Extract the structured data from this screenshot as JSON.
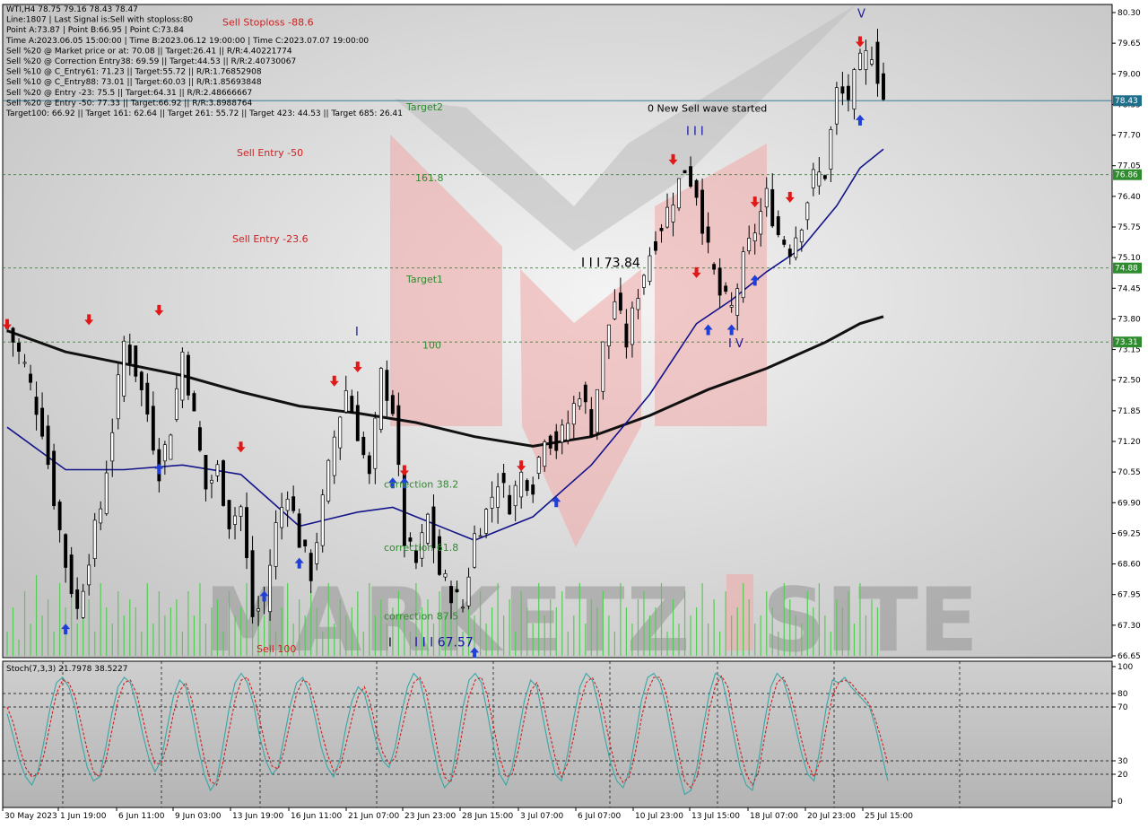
{
  "chart_data": [
    {
      "type": "candlestick",
      "symbol": "WTI,H4",
      "ohlc": {
        "open": 78.75,
        "high": 79.16,
        "low": 78.43,
        "close": 78.47
      },
      "info_lines": [
        "WTI,H4  78.75 79.16 78.43 78.47",
        "Line:1807 | Last Signal is:Sell with stoploss:80",
        "Point A:73.87 | Point B:66.95 | Point C:73.84",
        "Time A:2023.06.05 15:00:00 | Time B:2023.06.12 19:00:00 | Time C:2023.07.07 19:00:00",
        "Sell %20 @ Market price or at: 70.08 || Target:26.41 || R/R:4.40221774",
        "Sell %20 @ Correction Entry38: 69.59 || Target:44.53 || R/R:2.40730067",
        "Sell %10 @ C_Entry61: 71.23 || Target:55.72 || R/R:1.76852908",
        "Sell %10 @ C_Entry88: 73.01 || Target:60.03 || R/R:1.85693848",
        "Sell %20 @ Entry -23: 75.5 || Target:64.31 || R/R:2.48666667",
        "Sell %20 @ Entry -50: 77.33 || Target:66.92 || R/R:3.8988764",
        "Target100: 66.92 || Target 161: 62.64 || Target 261: 55.72 || Target 423: 44.53 || Target 685: 26.41"
      ],
      "y_ticks": [
        "80.30",
        "79.65",
        "79.00",
        "78.35",
        "77.70",
        "77.05",
        "76.40",
        "75.75",
        "75.10",
        "74.45",
        "73.80",
        "73.15",
        "72.50",
        "71.85",
        "71.20",
        "70.55",
        "69.90",
        "69.25",
        "68.60",
        "67.95",
        "67.30",
        "66.65"
      ],
      "ylim": [
        66.65,
        80.3
      ],
      "price_badges": [
        {
          "label": "78.43",
          "value": 78.43,
          "color": "#1f6f8b"
        },
        {
          "label": "76.86",
          "value": 76.86,
          "color": "#2e8b2e"
        },
        {
          "label": "74.88",
          "value": 74.88,
          "color": "#2e8b2e"
        },
        {
          "label": "73.31",
          "value": 73.31,
          "color": "#2e8b2e"
        }
      ],
      "levels": [
        {
          "label": "Sell Stoploss -88.6",
          "value": 80.1,
          "color": "#cc2222"
        },
        {
          "label": "Target2",
          "value": 78.3,
          "color": "#2e8b2e"
        },
        {
          "label": "Sell Entry -50",
          "value": 77.33,
          "color": "#cc2222"
        },
        {
          "label": "161.8",
          "value": 76.8,
          "color": "#2e8b2e"
        },
        {
          "label": "Sell Entry -23.6",
          "value": 75.5,
          "color": "#cc2222"
        },
        {
          "label": "Target1",
          "value": 74.65,
          "color": "#2e8b2e"
        },
        {
          "label": "100",
          "value": 73.25,
          "color": "#2e8b2e"
        },
        {
          "label": "correction 38.2",
          "value": 70.3,
          "color": "#2e8b2e"
        },
        {
          "label": "correction 61.8",
          "value": 68.95,
          "color": "#2e8b2e"
        },
        {
          "label": "correction 87.5",
          "value": 67.5,
          "color": "#2e8b2e"
        },
        {
          "label": "Sell 100",
          "value": 66.8,
          "color": "#cc2222"
        }
      ],
      "annotations": [
        {
          "text": "0 New Sell wave started",
          "value": 78.2,
          "color": "#000000"
        },
        {
          "text": "I I I 73.84",
          "value": 74.9,
          "color": "#000000"
        },
        {
          "text": "I I I",
          "value": 77.7,
          "color": "#1a1aa0"
        },
        {
          "text": "I V",
          "value": 73.2,
          "color": "#1a1aa0"
        },
        {
          "text": "V",
          "value": 80.2,
          "color": "#1a1aa0"
        },
        {
          "text": "I",
          "value": 73.45,
          "color": "#1a1aa0"
        },
        {
          "text": "I I I 67.57",
          "value": 66.85,
          "color": "#1a1aa0"
        },
        {
          "text": "I",
          "value": 66.85,
          "color": "#000000"
        }
      ],
      "x_ticks": [
        "30 May 2023",
        "1 Jun 19:00",
        "6 Jun 11:00",
        "9 Jun 03:00",
        "13 Jun 19:00",
        "16 Jun 11:00",
        "21 Jun 07:00",
        "23 Jun 23:00",
        "28 Jun 15:00",
        "3 Jul 07:00",
        "6 Jul 07:00",
        "10 Jul 23:00",
        "13 Jul 15:00",
        "18 Jul 07:00",
        "20 Jul 23:00",
        "25 Jul 15:00"
      ],
      "close_path": [
        [
          0,
          73.6
        ],
        [
          3,
          72.8
        ],
        [
          6,
          71.5
        ],
        [
          8,
          70.0
        ],
        [
          10,
          68.6
        ],
        [
          12,
          67.6
        ],
        [
          14,
          68.8
        ],
        [
          16,
          69.8
        ],
        [
          18,
          71.5
        ],
        [
          20,
          73.3
        ],
        [
          22,
          72.7
        ],
        [
          24,
          71.8
        ],
        [
          26,
          70.6
        ],
        [
          28,
          71.5
        ],
        [
          30,
          73.1
        ],
        [
          32,
          71.7
        ],
        [
          34,
          70.2
        ],
        [
          36,
          70.6
        ],
        [
          38,
          69.5
        ],
        [
          40,
          69.8
        ],
        [
          42,
          67.5
        ],
        [
          44,
          67.8
        ],
        [
          46,
          69.4
        ],
        [
          48,
          70.2
        ],
        [
          50,
          69.1
        ],
        [
          52,
          68.4
        ],
        [
          54,
          69.9
        ],
        [
          56,
          71.3
        ],
        [
          58,
          72.3
        ],
        [
          60,
          71.4
        ],
        [
          62,
          70.4
        ],
        [
          64,
          72.6
        ],
        [
          66,
          71.9
        ],
        [
          68,
          69.1
        ],
        [
          70,
          68.6
        ],
        [
          72,
          69.6
        ],
        [
          74,
          68.4
        ],
        [
          76,
          68.0
        ],
        [
          78,
          67.7
        ],
        [
          80,
          69.2
        ],
        [
          82,
          69.7
        ],
        [
          84,
          70.4
        ],
        [
          86,
          69.9
        ],
        [
          88,
          70.5
        ],
        [
          90,
          70.3
        ],
        [
          92,
          71.4
        ],
        [
          94,
          71.1
        ],
        [
          96,
          71.6
        ],
        [
          98,
          72.3
        ],
        [
          100,
          71.5
        ],
        [
          102,
          73.2
        ],
        [
          104,
          74.2
        ],
        [
          106,
          73.3
        ],
        [
          108,
          74.4
        ],
        [
          110,
          75.2
        ],
        [
          112,
          75.8
        ],
        [
          114,
          76.4
        ],
        [
          116,
          77.0
        ],
        [
          118,
          76.5
        ],
        [
          120,
          75.2
        ],
        [
          122,
          74.3
        ],
        [
          124,
          74.0
        ],
        [
          126,
          75.0
        ],
        [
          128,
          75.7
        ],
        [
          130,
          76.4
        ],
        [
          132,
          75.6
        ],
        [
          134,
          75.3
        ],
        [
          136,
          75.9
        ],
        [
          138,
          76.8
        ],
        [
          140,
          76.9
        ],
        [
          142,
          78.6
        ],
        [
          144,
          78.5
        ],
        [
          146,
          79.2
        ],
        [
          148,
          79.5
        ],
        [
          150,
          78.47
        ]
      ],
      "ma_fast": [
        [
          0,
          71.5
        ],
        [
          10,
          70.6
        ],
        [
          20,
          70.6
        ],
        [
          30,
          70.7
        ],
        [
          40,
          70.5
        ],
        [
          50,
          69.4
        ],
        [
          60,
          69.7
        ],
        [
          66,
          69.8
        ],
        [
          72,
          69.5
        ],
        [
          80,
          69.1
        ],
        [
          90,
          69.6
        ],
        [
          100,
          70.7
        ],
        [
          110,
          72.2
        ],
        [
          118,
          73.7
        ],
        [
          124,
          74.2
        ],
        [
          130,
          74.8
        ],
        [
          136,
          75.3
        ],
        [
          142,
          76.2
        ],
        [
          146,
          77.0
        ],
        [
          150,
          77.4
        ]
      ],
      "ma_slow": [
        [
          0,
          73.55
        ],
        [
          10,
          73.1
        ],
        [
          20,
          72.85
        ],
        [
          30,
          72.6
        ],
        [
          40,
          72.25
        ],
        [
          50,
          71.95
        ],
        [
          60,
          71.8
        ],
        [
          70,
          71.6
        ],
        [
          80,
          71.3
        ],
        [
          90,
          71.1
        ],
        [
          100,
          71.3
        ],
        [
          110,
          71.75
        ],
        [
          120,
          72.3
        ],
        [
          130,
          72.75
        ],
        [
          140,
          73.3
        ],
        [
          146,
          73.7
        ],
        [
          150,
          73.85
        ]
      ],
      "volumes": [
        3,
        6,
        2,
        8,
        4,
        10,
        5,
        7,
        3,
        9,
        6,
        8,
        4,
        5,
        7,
        3,
        9,
        6,
        4,
        8,
        5,
        7,
        6,
        3,
        9,
        4,
        8,
        5,
        6,
        7,
        3,
        8,
        5,
        9,
        4,
        6,
        7,
        3,
        8,
        5,
        6,
        9,
        4,
        7,
        5,
        8,
        3,
        6,
        9,
        4,
        7,
        5,
        8,
        6,
        3,
        9,
        4,
        7,
        5,
        6,
        8,
        3,
        9,
        5,
        7,
        4,
        6,
        8,
        5,
        3,
        9,
        6,
        7,
        4,
        8,
        5,
        6,
        9,
        3,
        7,
        5,
        8,
        4,
        6,
        9,
        5,
        7,
        3,
        8,
        6,
        4,
        9,
        5,
        7,
        6,
        8,
        3,
        5,
        9,
        4,
        7,
        6,
        8,
        5,
        3,
        9,
        6,
        4,
        7,
        8,
        5,
        6,
        9,
        3,
        7,
        4,
        8,
        5,
        6,
        9,
        4,
        7,
        3,
        8,
        5,
        6,
        9,
        7,
        4,
        5,
        8,
        6,
        3,
        9,
        7,
        5,
        4,
        8,
        6,
        9,
        5,
        3,
        7,
        6,
        8,
        4,
        9,
        5,
        7,
        6
      ],
      "buy_arrows": [
        [
          10,
          67.2
        ],
        [
          26,
          70.6
        ],
        [
          44,
          67.9
        ],
        [
          50,
          68.6
        ],
        [
          66,
          70.3
        ],
        [
          68,
          70.3
        ],
        [
          80,
          66.7
        ],
        [
          94,
          69.9
        ],
        [
          120,
          73.55
        ],
        [
          124,
          73.55
        ],
        [
          128,
          74.6
        ],
        [
          146,
          78.0
        ]
      ],
      "sell_arrows": [
        [
          0,
          73.7
        ],
        [
          14,
          73.8
        ],
        [
          26,
          74.0
        ],
        [
          40,
          71.1
        ],
        [
          56,
          72.5
        ],
        [
          60,
          72.8
        ],
        [
          68,
          70.6
        ],
        [
          88,
          70.7
        ],
        [
          114,
          77.2
        ],
        [
          118,
          74.8
        ],
        [
          128,
          76.3
        ],
        [
          134,
          76.4
        ],
        [
          146,
          79.7
        ]
      ]
    },
    {
      "type": "line",
      "title": "Stoch(7,3,3) 21.7978 38.5227",
      "ylim": [
        0,
        100
      ],
      "y_ticks": [
        "100",
        "80",
        "70",
        "30",
        "20",
        "0"
      ],
      "series": [
        {
          "name": "main",
          "color": "#3aa6a6",
          "values": [
            65,
            48,
            30,
            18,
            12,
            22,
            45,
            70,
            88,
            92,
            85,
            70,
            45,
            25,
            15,
            18,
            40,
            65,
            85,
            92,
            88,
            72,
            50,
            32,
            22,
            30,
            55,
            78,
            90,
            85,
            65,
            40,
            20,
            8,
            15,
            40,
            68,
            88,
            95,
            88,
            72,
            48,
            30,
            20,
            25,
            48,
            72,
            88,
            92,
            82,
            62,
            40,
            25,
            18,
            30,
            55,
            75,
            85,
            80,
            62,
            42,
            30,
            25,
            40,
            65,
            85,
            95,
            90,
            70,
            45,
            22,
            10,
            15,
            40,
            70,
            90,
            95,
            88,
            65,
            40,
            20,
            12,
            25,
            50,
            75,
            90,
            85,
            62,
            38,
            20,
            15,
            35,
            62,
            85,
            95,
            90,
            72,
            48,
            28,
            15,
            10,
            22,
            48,
            75,
            92,
            95,
            88,
            70,
            45,
            22,
            5,
            8,
            25,
            55,
            80,
            95,
            92,
            72,
            48,
            25,
            12,
            8,
            30,
            60,
            85,
            95,
            90,
            75,
            55,
            35,
            20,
            15,
            40,
            70,
            90,
            88,
            92,
            85,
            80,
            75,
            70,
            55,
            35,
            15
          ]
        },
        {
          "name": "signal",
          "color": "#cc2222",
          "values": [
            70,
            58,
            40,
            25,
            18,
            20,
            35,
            58,
            80,
            90,
            88,
            78,
            58,
            38,
            22,
            18,
            30,
            52,
            75,
            88,
            90,
            80,
            62,
            42,
            28,
            28,
            42,
            65,
            82,
            88,
            75,
            55,
            32,
            15,
            12,
            28,
            52,
            75,
            90,
            92,
            80,
            60,
            40,
            26,
            24,
            38,
            60,
            80,
            90,
            88,
            72,
            52,
            35,
            22,
            25,
            42,
            62,
            78,
            85,
            72,
            52,
            36,
            28,
            32,
            52,
            72,
            88,
            92,
            82,
            60,
            35,
            18,
            14,
            28,
            55,
            78,
            90,
            92,
            78,
            55,
            32,
            18,
            20,
            38,
            62,
            82,
            88,
            75,
            52,
            32,
            18,
            28,
            48,
            72,
            88,
            92,
            82,
            62,
            40,
            22,
            14,
            18,
            36,
            62,
            82,
            92,
            92,
            80,
            58,
            35,
            15,
            10,
            18,
            40,
            68,
            86,
            93,
            85,
            60,
            38,
            20,
            12,
            22,
            48,
            72,
            88,
            92,
            82,
            65,
            45,
            28,
            18,
            30,
            55,
            78,
            88,
            90,
            88,
            82,
            78,
            72,
            60,
            45,
            28
          ]
        }
      ]
    }
  ],
  "watermark": {
    "text": "MARKETZISITE"
  }
}
